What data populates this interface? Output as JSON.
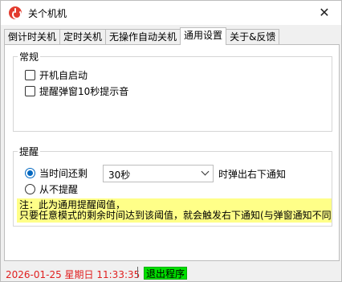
{
  "window": {
    "title": "关个机机"
  },
  "tabs": [
    "倒计时关机",
    "定时关机",
    "无操作自动关机",
    "通用设置",
    "关于&反馈"
  ],
  "general_group": {
    "title": "常规",
    "options": [
      "开机自启动",
      "提醒弹窗10秒提示音"
    ]
  },
  "reminder_group": {
    "title": "提醒",
    "option_remaining": "当时间还剩",
    "threshold_value": "30秒",
    "threshold_suffix": "时弹出右下通知",
    "option_never": "从不提醒",
    "note_line1": "注：此为通用提醒阈值，",
    "note_line2": "只要任意模式的剩余时间达到该阈值，就会触发右下通知(与弹窗通知不同"
  },
  "status": {
    "datetime": "2026-01-25 星期日 11:33:35",
    "exit_label": "退出程序"
  },
  "colors": {
    "note_bg": "#ffff88",
    "datetime": "#e02020",
    "exit_bg": "#00e000",
    "accent": "#0067c0"
  }
}
